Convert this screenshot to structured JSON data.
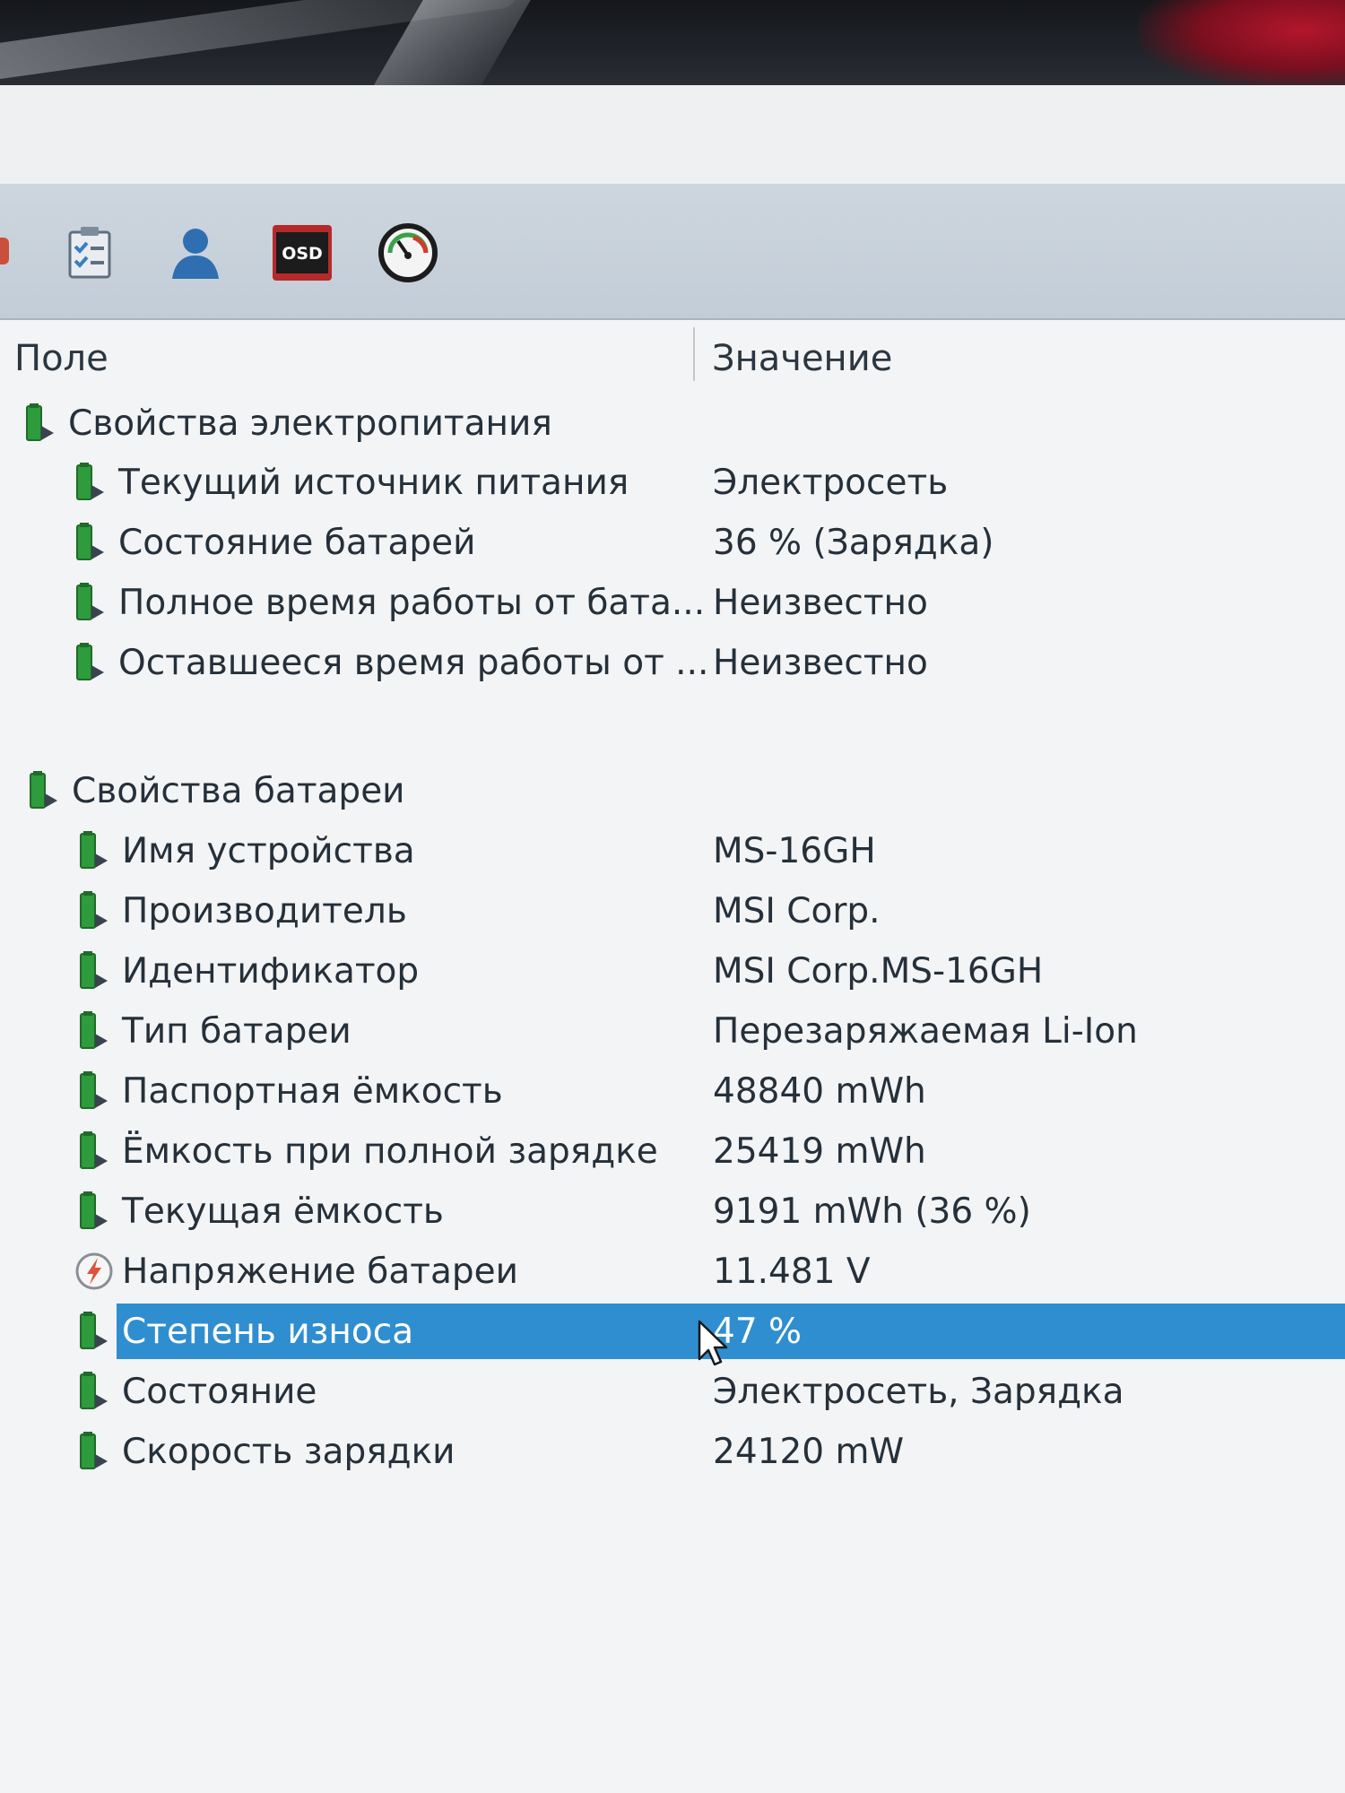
{
  "columns": {
    "field": "Поле",
    "value": "Значение"
  },
  "toolbar": {
    "buttons": [
      {
        "name": "report-icon"
      },
      {
        "name": "user-icon"
      },
      {
        "name": "osd-icon",
        "label": "OSD"
      },
      {
        "name": "gauge-icon"
      }
    ]
  },
  "groups": {
    "power": {
      "title": "Свойства электропитания",
      "rows": [
        {
          "field": "Текущий источник питания",
          "value": "Электросеть"
        },
        {
          "field": "Состояние батарей",
          "value": "36 % (Зарядка)"
        },
        {
          "field": "Полное время работы от бата...",
          "value": "Неизвестно"
        },
        {
          "field": "Оставшееся время работы от ...",
          "value": "Неизвестно"
        }
      ]
    },
    "battery": {
      "title": "Свойства батареи",
      "rows": [
        {
          "field": "Имя устройства",
          "value": "MS-16GH"
        },
        {
          "field": "Производитель",
          "value": "MSI Corp."
        },
        {
          "field": "Идентификатор",
          "value": "MSI Corp.MS-16GH"
        },
        {
          "field": "Тип батареи",
          "value": "Перезаряжаемая Li-Ion"
        },
        {
          "field": "Паспортная ёмкость",
          "value": "48840 mWh"
        },
        {
          "field": "Ёмкость при полной зарядке",
          "value": "25419 mWh"
        },
        {
          "field": "Текущая ёмкость",
          "value": "9191 mWh  (36 %)"
        },
        {
          "field": "Напряжение батареи",
          "value": "11.481 V",
          "icon": "voltage-icon"
        },
        {
          "field": "Степень износа",
          "value": "47 %",
          "selected": true
        },
        {
          "field": "Состояние",
          "value": "Электросеть, Зарядка"
        },
        {
          "field": "Скорость зарядки",
          "value": "24120 mW"
        }
      ]
    }
  },
  "colors": {
    "selection": "#2f8ed0",
    "battery_icon": "#2e9b3c"
  }
}
